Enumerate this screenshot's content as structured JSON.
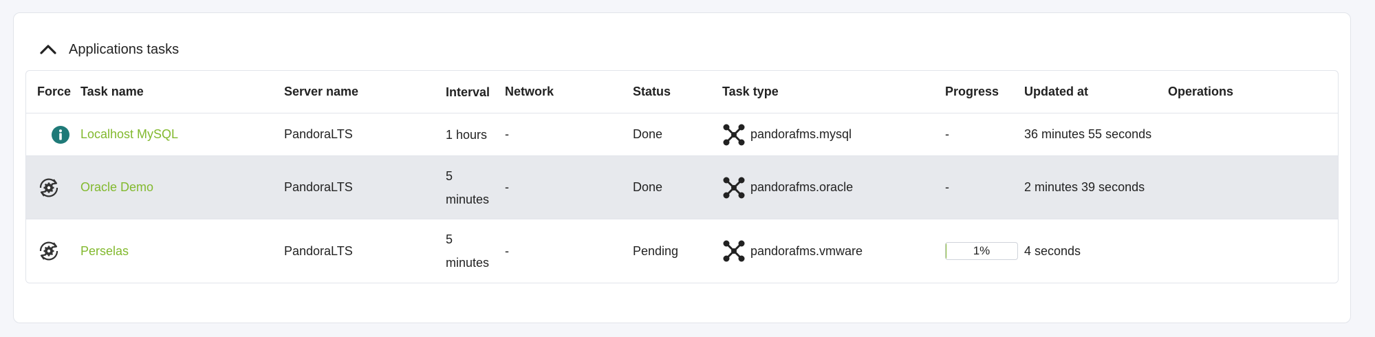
{
  "panel": {
    "title": "Applications tasks"
  },
  "table": {
    "columns": {
      "force": "Force",
      "task_name": "Task name",
      "server_name": "Server name",
      "interval": "Interval",
      "network": "Network",
      "status": "Status",
      "task_type": "Task type",
      "progress": "Progress",
      "updated_at": "Updated at",
      "operations": "Operations"
    },
    "rows": [
      {
        "force_icon": "info-icon",
        "task_name": "Localhost MySQL",
        "server_name": "PandoraLTS",
        "interval": "1 hours",
        "network": "-",
        "status": "Done",
        "task_type": "pandorafms.mysql",
        "progress": "-",
        "updated_at": "36 minutes 55 seconds"
      },
      {
        "force_icon": "force-run-icon",
        "task_name": "Oracle Demo",
        "server_name": "PandoraLTS",
        "interval_line1": "5",
        "interval_line2": "minutes",
        "network": "-",
        "status": "Done",
        "task_type": "pandorafms.oracle",
        "progress": "-",
        "updated_at": "2 minutes 39 seconds"
      },
      {
        "force_icon": "force-run-icon",
        "task_name": "Perselas",
        "server_name": "PandoraLTS",
        "interval_line1": "5",
        "interval_line2": "minutes",
        "network": "-",
        "status": "Pending",
        "task_type": "pandorafms.vmware",
        "progress_value": 1,
        "progress_label": "1%",
        "updated_at": "4 seconds"
      }
    ]
  },
  "colors": {
    "link": "#82b92e",
    "info_icon": "#1f7a78",
    "selected_row": "#e7e9ed"
  }
}
